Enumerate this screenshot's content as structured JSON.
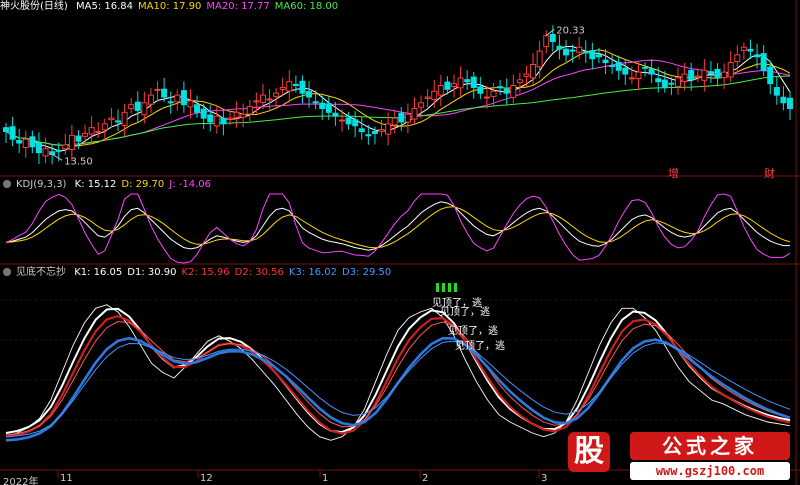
{
  "panels": {
    "main": {
      "title": "神火股份(日线)",
      "ma": [
        {
          "label": "MA5: 16.84",
          "color": "#ffffff"
        },
        {
          "label": "MA10: 17.90",
          "color": "#ffd700"
        },
        {
          "label": "MA20: 17.77",
          "color": "#ff44ff"
        },
        {
          "label": "MA60: 18.00",
          "color": "#44ee44"
        }
      ],
      "high_label": "20.33",
      "low_label": "13.50",
      "badges": [
        "增",
        "财"
      ]
    },
    "kdj": {
      "title": "KDJ(9,3,3)",
      "values": [
        {
          "label": "K: 15.12",
          "color": "#ffffff"
        },
        {
          "label": "D: 29.70",
          "color": "#ffd700"
        },
        {
          "label": "J: -14.06",
          "color": "#ff44ff"
        }
      ]
    },
    "jdbwc": {
      "title": "见底不忘抄",
      "values": [
        {
          "label": "K1: 16.05",
          "color": "#ffffff"
        },
        {
          "label": "D1: 30.90",
          "color": "#ffffff"
        },
        {
          "label": "K2: 15.96",
          "color": "#ff3333"
        },
        {
          "label": "D2: 30.56",
          "color": "#ff3333"
        },
        {
          "label": "K3: 16.02",
          "color": "#4499ff"
        },
        {
          "label": "D3: 29.50",
          "color": "#4499ff"
        }
      ],
      "signal_text": [
        "见顶了，逃",
        "见顶了，逃",
        "见顶了，逃",
        "见顶了，逃"
      ]
    }
  },
  "date_axis": [
    "2022年",
    "11",
    "12",
    "1",
    "2",
    "3"
  ],
  "logo": {
    "glyph": "股",
    "title": "公式之家",
    "url": "www.gszj100.com"
  },
  "colors": {
    "up": "#ff3b3b",
    "down": "#00e0e0",
    "grid": "#7a1010"
  },
  "chart_data": {
    "type": "candlestick",
    "title": "神火股份(日线)",
    "x_dates": [
      "2022年",
      "11",
      "12",
      "1",
      "2",
      "3"
    ],
    "price_extremes": {
      "high": 20.33,
      "low": 13.5
    },
    "moving_average_last": {
      "MA5": 16.84,
      "MA10": 17.9,
      "MA20": 17.77,
      "MA60": 18.0
    },
    "kdj_last": {
      "K": 15.12,
      "D": 29.7,
      "J": -14.06
    },
    "indicator_last": {
      "K1": 16.05,
      "D1": 30.9,
      "K2": 15.96,
      "D2": 30.56,
      "K3": 16.02,
      "D3": 29.5
    },
    "close_approx": [
      15.0,
      14.6,
      14.4,
      14.6,
      14.2,
      13.9,
      14.1,
      13.8,
      14.0,
      14.3,
      14.8,
      14.5,
      14.9,
      15.2,
      15.0,
      15.4,
      15.7,
      15.5,
      16.0,
      16.4,
      16.1,
      16.5,
      16.9,
      17.2,
      16.8,
      16.5,
      16.9,
      16.4,
      16.6,
      16.0,
      15.7,
      15.5,
      15.8,
      15.4,
      15.7,
      16.0,
      15.9,
      16.3,
      16.6,
      16.9,
      16.7,
      17.0,
      17.3,
      17.6,
      17.4,
      17.0,
      16.8,
      16.5,
      16.2,
      16.0,
      15.8,
      15.6,
      15.4,
      15.3,
      15.0,
      14.8,
      14.9,
      15.1,
      15.4,
      15.7,
      15.5,
      15.9,
      16.2,
      16.5,
      16.8,
      17.1,
      17.4,
      17.2,
      17.5,
      17.8,
      17.6,
      17.3,
      17.0,
      16.8,
      17.1,
      17.3,
      17.0,
      17.4,
      17.7,
      18.0,
      18.5,
      19.2,
      20.0,
      19.7,
      19.3,
      19.0,
      19.2,
      19.4,
      19.1,
      18.8,
      18.9,
      18.6,
      18.4,
      18.2,
      18.0,
      17.8,
      18.1,
      18.3,
      18.0,
      17.6,
      17.3,
      17.5,
      17.8,
      18.0,
      17.7,
      17.9,
      18.2,
      18.0,
      17.8,
      18.1,
      18.6,
      19.0,
      19.4,
      19.2,
      18.9,
      18.2,
      17.5,
      16.9,
      16.5,
      16.2
    ],
    "kdj_k_approx": [
      20,
      22,
      25,
      28,
      35,
      45,
      55,
      62,
      68,
      70,
      68,
      60,
      50,
      40,
      30,
      28,
      35,
      45,
      60,
      70,
      72,
      65,
      55,
      45,
      35,
      25,
      18,
      12,
      10,
      12,
      18,
      25,
      30,
      28,
      25,
      22,
      20,
      22,
      30,
      45,
      60,
      70,
      72,
      68,
      55,
      42,
      35,
      30,
      25,
      22,
      20,
      18,
      15,
      12,
      10,
      8,
      10,
      15,
      22,
      30,
      38,
      45,
      55,
      65,
      72,
      78,
      82,
      80,
      75,
      65,
      55,
      45,
      38,
      32,
      30,
      35,
      42,
      50,
      58,
      65,
      70,
      72,
      68,
      60,
      50,
      40,
      30,
      22,
      18,
      15,
      14,
      18,
      25,
      35,
      45,
      55,
      60,
      62,
      58,
      50,
      42,
      35,
      30,
      28,
      30,
      35,
      45,
      55,
      65,
      70,
      72,
      65,
      55,
      45,
      35,
      28,
      22,
      18,
      15,
      15
    ],
    "indicator_k1_approx": [
      10,
      12,
      15,
      20,
      30,
      45,
      60,
      72,
      80,
      82,
      78,
      70,
      60,
      50,
      45,
      42,
      48,
      55,
      62,
      65,
      62,
      58,
      52,
      45,
      38,
      30,
      22,
      15,
      10,
      8,
      10,
      15,
      25,
      40,
      55,
      68,
      75,
      78,
      80,
      75,
      65,
      52,
      40,
      30,
      22,
      18,
      15,
      12,
      10,
      12,
      18,
      30,
      45,
      60,
      72,
      80,
      80,
      75,
      68,
      58,
      48,
      40,
      35,
      30,
      28,
      25,
      22,
      20,
      18,
      17,
      16
    ]
  }
}
